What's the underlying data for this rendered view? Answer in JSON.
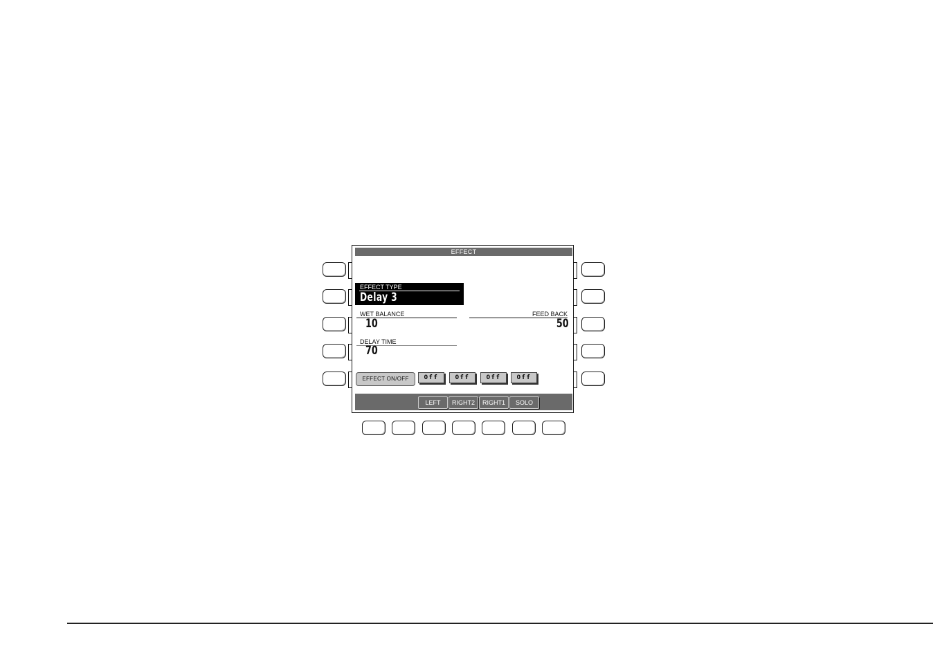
{
  "screen": {
    "title": "EFFECT",
    "effect_type": {
      "label": "EFFECT TYPE",
      "value": "Delay 3"
    },
    "params": {
      "wet_balance": {
        "label": "WET BALANCE",
        "value": "10"
      },
      "feed_back": {
        "label": "FEED BACK",
        "value": "50"
      },
      "delay_time": {
        "label": "DELAY TIME",
        "value": "70"
      }
    },
    "effect_onoff": {
      "label": "EFFECT ON/OFF"
    },
    "part_states": [
      "Off",
      "Off",
      "Off",
      "Off"
    ],
    "parts": [
      "LEFT",
      "RIGHT2",
      "RIGHT1",
      "SOLO"
    ]
  },
  "colors": {
    "title_bar": "#6a6a6a",
    "button_gray": "#c8c8c8",
    "highlight": "#000000"
  }
}
